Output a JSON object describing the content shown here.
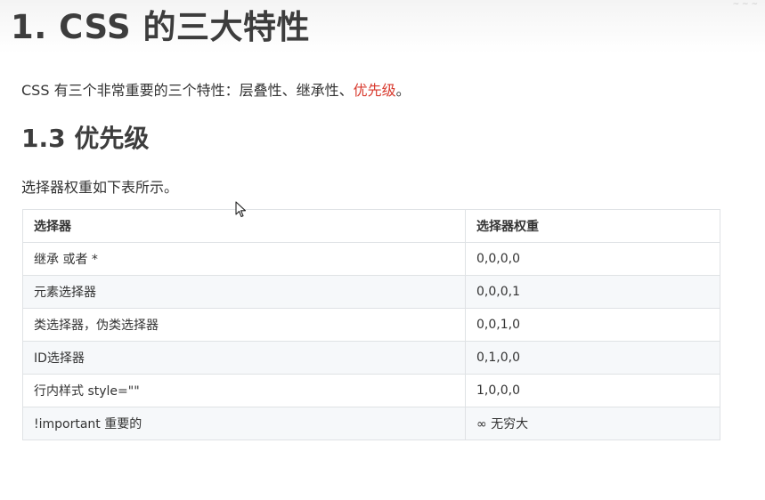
{
  "heading1": "1. CSS 的三大特性",
  "corner_mark": "~ ~ ~",
  "intro": {
    "prefix": "CSS 有三个非常重要的三个特性：层叠性、继承性、",
    "highlight": "优先级",
    "suffix": "。",
    "highlight_color": "#d83a2e"
  },
  "heading2": "1.3 优先级",
  "description": "选择器权重如下表所示。",
  "table": {
    "headers": [
      "选择器",
      "选择器权重"
    ],
    "rows": [
      {
        "selector": "继承 或者 *",
        "weight": "0,0,0,0"
      },
      {
        "selector": "元素选择器",
        "weight": "0,0,0,1"
      },
      {
        "selector": "类选择器，伪类选择器",
        "weight": "0,0,1,0"
      },
      {
        "selector": "ID选择器",
        "weight": "0,1,0,0"
      },
      {
        "selector": "行内样式 style=\"\"",
        "weight": "1,0,0,0"
      },
      {
        "selector": "!important  重要的",
        "weight": "∞ 无穷大"
      }
    ]
  }
}
